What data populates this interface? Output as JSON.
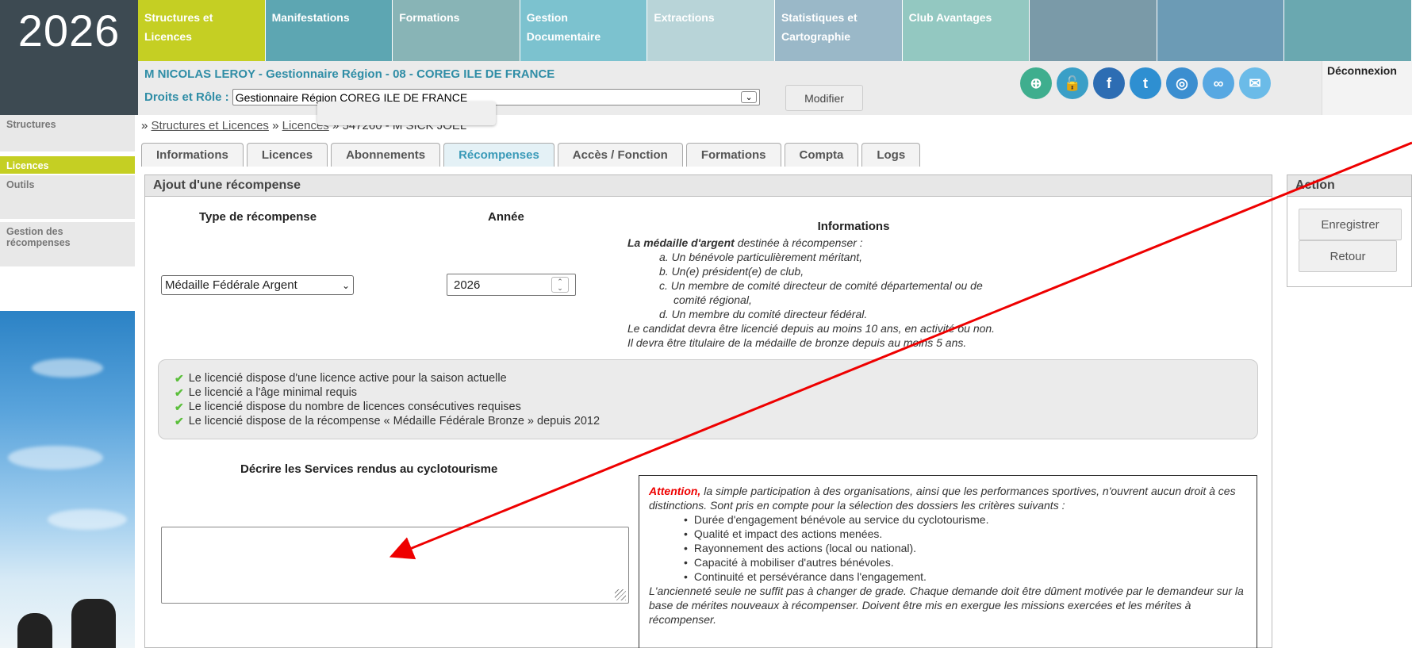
{
  "logo": "2026",
  "topnav": [
    {
      "label": "Structures et Licences",
      "color": "#c5cf23"
    },
    {
      "label": "Manifestations",
      "color": "#5da6b2"
    },
    {
      "label": "Formations",
      "color": "#88b4b6"
    },
    {
      "label": "Gestion Documentaire",
      "color": "#7cc2cf"
    },
    {
      "label": "Extractions",
      "color": "#b8d4d8"
    },
    {
      "label": "Statistiques et Cartographie",
      "color": "#9ab8c8"
    },
    {
      "label": "Club Avantages",
      "color": "#93c8c1"
    },
    {
      "label": "",
      "color": "#7a9aa8"
    },
    {
      "label": "",
      "color": "#6c9bb5"
    },
    {
      "label": "",
      "color": "#6aa8b0"
    }
  ],
  "user": {
    "name": "M NICOLAS LEROY",
    "role": " - Gestionnaire Région - 08 - COREG ILE DE FRANCE",
    "rights_label": "Droits et Rôle :",
    "rights_value": "Gestionnaire Région COREG ILE DE FRANCE",
    "modify": "Modifier",
    "logout": "Déconnexion"
  },
  "social_icons": [
    {
      "name": "search-plus-icon",
      "glyph": "⊕",
      "color": "#3fae8e"
    },
    {
      "name": "lock-icon",
      "glyph": "🔓",
      "color": "#3a9fc7"
    },
    {
      "name": "facebook-icon",
      "glyph": "f",
      "color": "#2d6db3"
    },
    {
      "name": "twitter-icon",
      "glyph": "t",
      "color": "#2e8fd1"
    },
    {
      "name": "instagram-icon",
      "glyph": "◎",
      "color": "#3b8ed0"
    },
    {
      "name": "bike-icon",
      "glyph": "∞",
      "color": "#57a8e2"
    },
    {
      "name": "mail-icon",
      "glyph": "✉",
      "color": "#6bbbe8"
    }
  ],
  "sidebar": {
    "structures": "Structures",
    "licences": "Licences",
    "outils": "Outils",
    "gestion": "Gestion des récompenses"
  },
  "breadcrumb": {
    "sep": "»",
    "link1": "Structures et Licences",
    "link2": "Licences",
    "current": "547260 - M SICK JOEL"
  },
  "tabs": [
    "Informations",
    "Licences",
    "Abonnements",
    "Récompenses",
    "Accès / Fonction",
    "Formations",
    "Compta",
    "Logs"
  ],
  "panel": {
    "title": "Ajout d'une récompense",
    "type_head": "Type de récompense",
    "year_head": "Année",
    "type_value": "Médaille Fédérale Argent",
    "year_value": "2026"
  },
  "info": {
    "title": "Informations",
    "lead_bold": "La médaille d'argent",
    "lead_rest": " destinée à récompenser :",
    "items": [
      "a. Un bénévole particulièrement méritant,",
      "b. Un(e) président(e) de club,",
      "c. Un membre de comité directeur de comité départemental ou de",
      "comité régional,",
      "d. Un membre du comité directeur fédéral."
    ],
    "line1": "Le candidat devra être licencié depuis au moins 10 ans, en activité ou non.",
    "line2": "Il devra être titulaire de la médaille de bronze depuis au moins 5 ans."
  },
  "checks": [
    "Le licencié dispose d'une licence active pour la saison actuelle",
    "Le licencié a l'âge minimal requis",
    "Le licencié dispose du nombre de licences consécutives requises",
    "Le licencié dispose de la récompense « Médaille Fédérale Bronze » depuis 2012"
  ],
  "desc_label": "Décrire les Services rendus au cyclotourisme",
  "attention": {
    "red": "Attention,",
    "intro": " la simple participation à des organisations, ainsi que les performances sportives, n'ouvrent aucun droit à ces distinctions. Sont pris en compte pour la sélection des dossiers les critères suivants :",
    "items": [
      "Durée d'engagement bénévole au service du cyclotourisme.",
      "Qualité et impact des actions menées.",
      "Rayonnement des actions (local ou national).",
      "Capacité à mobiliser d'autres bénévoles.",
      "Continuité et persévérance dans l'engagement."
    ],
    "outro": "L'ancienneté seule ne suffit pas à changer de grade. Chaque demande doit être dûment motivée par le demandeur sur la base de mérites nouveaux à récompenser. Doivent être mis en exergue les missions exercées et les mérites à récompenser."
  },
  "action": {
    "title": "Action",
    "save": "Enregistrer",
    "back": "Retour"
  }
}
